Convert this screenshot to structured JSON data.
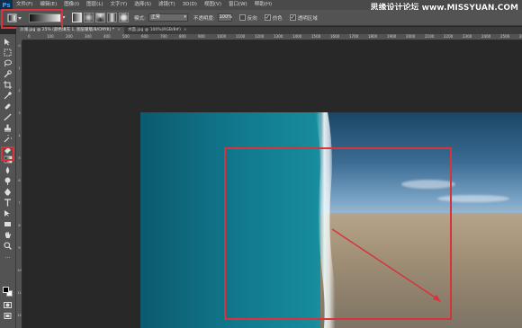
{
  "app": {
    "logo": "Ps",
    "watermark": "思缘设计论坛 www.MISSYUAN.COM"
  },
  "menu": [
    "文件(F)",
    "编辑(E)",
    "图像(I)",
    "图层(L)",
    "文字(Y)",
    "选择(S)",
    "滤镜(T)",
    "3D(D)",
    "视图(V)",
    "窗口(W)",
    "帮助(H)"
  ],
  "options": {
    "mode_label": "模式:",
    "mode_value": "正常",
    "opacity_label": "不透明度:",
    "opacity_value": "100%",
    "reverse_label": "反向",
    "dither_label": "仿色",
    "transparency_label": "透明区域",
    "reverse_checked": false,
    "dither_checked": true,
    "transparency_checked": true
  },
  "tabs": [
    {
      "label": "沙滩.jpg @ 25% (颜色填充 1, 图层蒙版/8/CMYK) *",
      "active": true
    },
    {
      "label": "水面.jpg @ 100%(RGB/8#)",
      "active": false
    }
  ],
  "ruler": {
    "top_ticks": [
      "0",
      "100",
      "200",
      "300",
      "400",
      "500",
      "600",
      "700",
      "800",
      "900",
      "1000",
      "1100",
      "1200",
      "1300",
      "1400",
      "1500",
      "1600",
      "1700",
      "1800",
      "1900",
      "2000",
      "2100",
      "2200",
      "2300",
      "2400",
      "2500",
      "2600"
    ],
    "left_ticks": [
      "0",
      "1",
      "2",
      "3",
      "4",
      "5",
      "6",
      "7",
      "8",
      "9",
      "10",
      "11",
      "12"
    ]
  },
  "tools": [
    "move-icon",
    "marquee-icon",
    "lasso-icon",
    "quick-select-icon",
    "crop-icon",
    "eyedropper-icon",
    "healing-brush-icon",
    "brush-icon",
    "clone-stamp-icon",
    "history-brush-icon",
    "eraser-icon",
    "gradient-icon",
    "blur-icon",
    "dodge-icon",
    "pen-icon",
    "type-icon",
    "path-select-icon",
    "rectangle-icon",
    "hand-icon",
    "zoom-icon"
  ],
  "colors": {
    "highlight": "#d6333a",
    "foreground": "#000000",
    "background": "#ffffff"
  }
}
